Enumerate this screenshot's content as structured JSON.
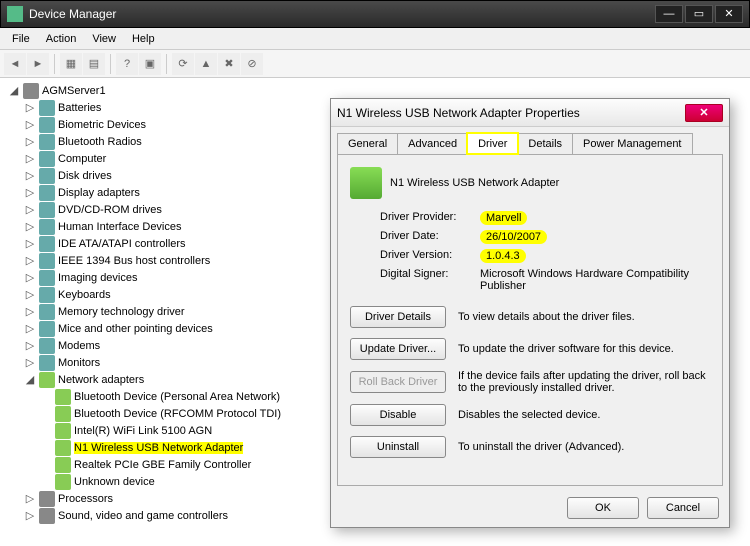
{
  "window": {
    "title": "Device Manager",
    "buttons": {
      "min": "—",
      "max": "▭",
      "close": "✕"
    }
  },
  "menu": {
    "file": "File",
    "action": "Action",
    "view": "View",
    "help": "Help"
  },
  "tree": {
    "root": "AGMServer1",
    "items": [
      "Batteries",
      "Biometric Devices",
      "Bluetooth Radios",
      "Computer",
      "Disk drives",
      "Display adapters",
      "DVD/CD-ROM drives",
      "Human Interface Devices",
      "IDE ATA/ATAPI controllers",
      "IEEE 1394 Bus host controllers",
      "Imaging devices",
      "Keyboards",
      "Memory technology driver",
      "Mice and other pointing devices",
      "Modems",
      "Monitors"
    ],
    "net_label": "Network adapters",
    "net_children": [
      "Bluetooth Device (Personal Area Network)",
      "Bluetooth Device (RFCOMM Protocol TDI)",
      "Intel(R) WiFi Link 5100 AGN",
      "N1 Wireless USB Network Adapter",
      "Realtek PCIe GBE Family Controller",
      "Unknown device"
    ],
    "after": [
      "Processors",
      "Sound, video and game controllers"
    ]
  },
  "dialog": {
    "title": "N1 Wireless USB Network Adapter Properties",
    "tabs": {
      "general": "General",
      "advanced": "Advanced",
      "driver": "Driver",
      "details": "Details",
      "power": "Power Management"
    },
    "device_name": "N1 Wireless USB Network Adapter",
    "fields": {
      "provider_label": "Driver Provider:",
      "provider_val": "Marvell",
      "date_label": "Driver Date:",
      "date_val": "26/10/2007",
      "version_label": "Driver Version:",
      "version_val": "1.0.4.3",
      "signer_label": "Digital Signer:",
      "signer_val": "Microsoft Windows Hardware Compatibility Publisher"
    },
    "actions": {
      "details_btn": "Driver Details",
      "details_desc": "To view details about the driver files.",
      "update_btn": "Update Driver...",
      "update_desc": "To update the driver software for this device.",
      "rollback_btn": "Roll Back Driver",
      "rollback_desc": "If the device fails after updating the driver, roll back to the previously installed driver.",
      "disable_btn": "Disable",
      "disable_desc": "Disables the selected device.",
      "uninstall_btn": "Uninstall",
      "uninstall_desc": "To uninstall the driver (Advanced)."
    },
    "ok": "OK",
    "cancel": "Cancel"
  }
}
